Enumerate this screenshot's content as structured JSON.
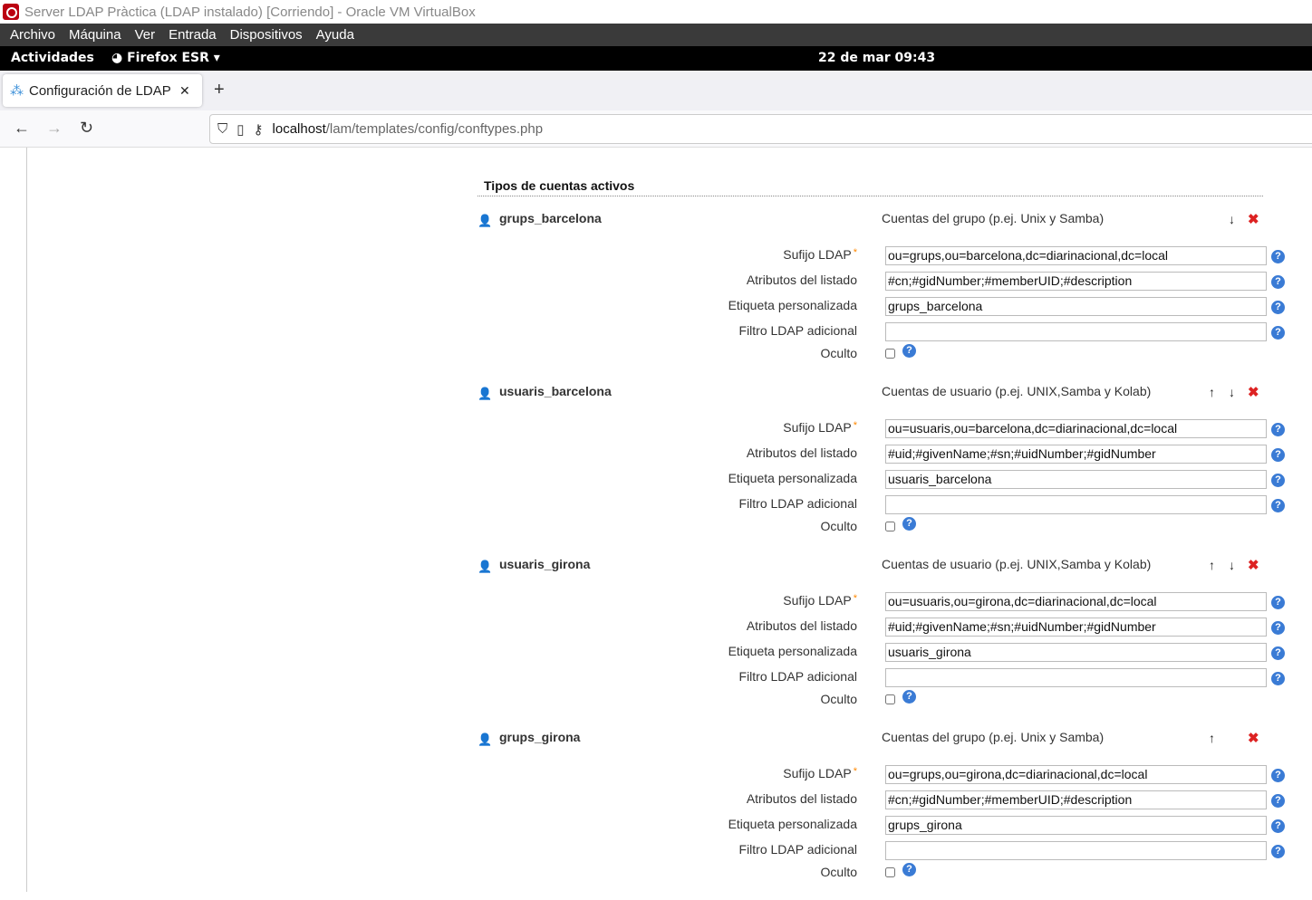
{
  "window": {
    "title": "Server LDAP Pràctica (LDAP instalado) [Corriendo] - Oracle VM VirtualBox"
  },
  "menu": [
    "Archivo",
    "Máquina",
    "Ver",
    "Entrada",
    "Dispositivos",
    "Ayuda"
  ],
  "gnome": {
    "activities": "Actividades",
    "app": "Firefox ESR ▾",
    "clock": "22 de mar  09:43"
  },
  "browser": {
    "tab_title": "Configuración de LDAP Account Manager",
    "url_host": "localhost",
    "url_path": "/lam/templates/config/conftypes.php"
  },
  "page": {
    "heading": "Tipos de cuentas activos",
    "labels": {
      "suffix": "Sufijo LDAP",
      "attrs": "Atributos del listado",
      "custom": "Etiqueta personalizada",
      "filter": "Filtro LDAP adicional",
      "hidden": "Oculto",
      "required": "*",
      "help": "?"
    },
    "types": [
      {
        "name": "grups_barcelona",
        "icon": "group-icon",
        "desc": "Cuentas del grupo (p.ej. Unix y Samba)",
        "up": false,
        "down": true,
        "suffix": "ou=grups,ou=barcelona,dc=diarinacional,dc=local",
        "attrs": "#cn;#gidNumber;#memberUID;#description",
        "custom": "grups_barcelona",
        "filter": "",
        "hidden": false
      },
      {
        "name": "usuaris_barcelona",
        "icon": "user-icon",
        "desc": "Cuentas de usuario (p.ej. UNIX,Samba y Kolab)",
        "up": true,
        "down": true,
        "suffix": "ou=usuaris,ou=barcelona,dc=diarinacional,dc=local",
        "attrs": "#uid;#givenName;#sn;#uidNumber;#gidNumber",
        "custom": "usuaris_barcelona",
        "filter": "",
        "hidden": false
      },
      {
        "name": "usuaris_girona",
        "icon": "user-icon",
        "desc": "Cuentas de usuario (p.ej. UNIX,Samba y Kolab)",
        "up": true,
        "down": true,
        "suffix": "ou=usuaris,ou=girona,dc=diarinacional,dc=local",
        "attrs": "#uid;#givenName;#sn;#uidNumber;#gidNumber",
        "custom": "usuaris_girona",
        "filter": "",
        "hidden": false
      },
      {
        "name": "grups_girona",
        "icon": "group-icon",
        "desc": "Cuentas del grupo (p.ej. Unix y Samba)",
        "up": true,
        "down": false,
        "suffix": "ou=grups,ou=girona,dc=diarinacional,dc=local",
        "attrs": "#cn;#gidNumber;#memberUID;#description",
        "custom": "grups_girona",
        "filter": "",
        "hidden": false
      }
    ]
  }
}
